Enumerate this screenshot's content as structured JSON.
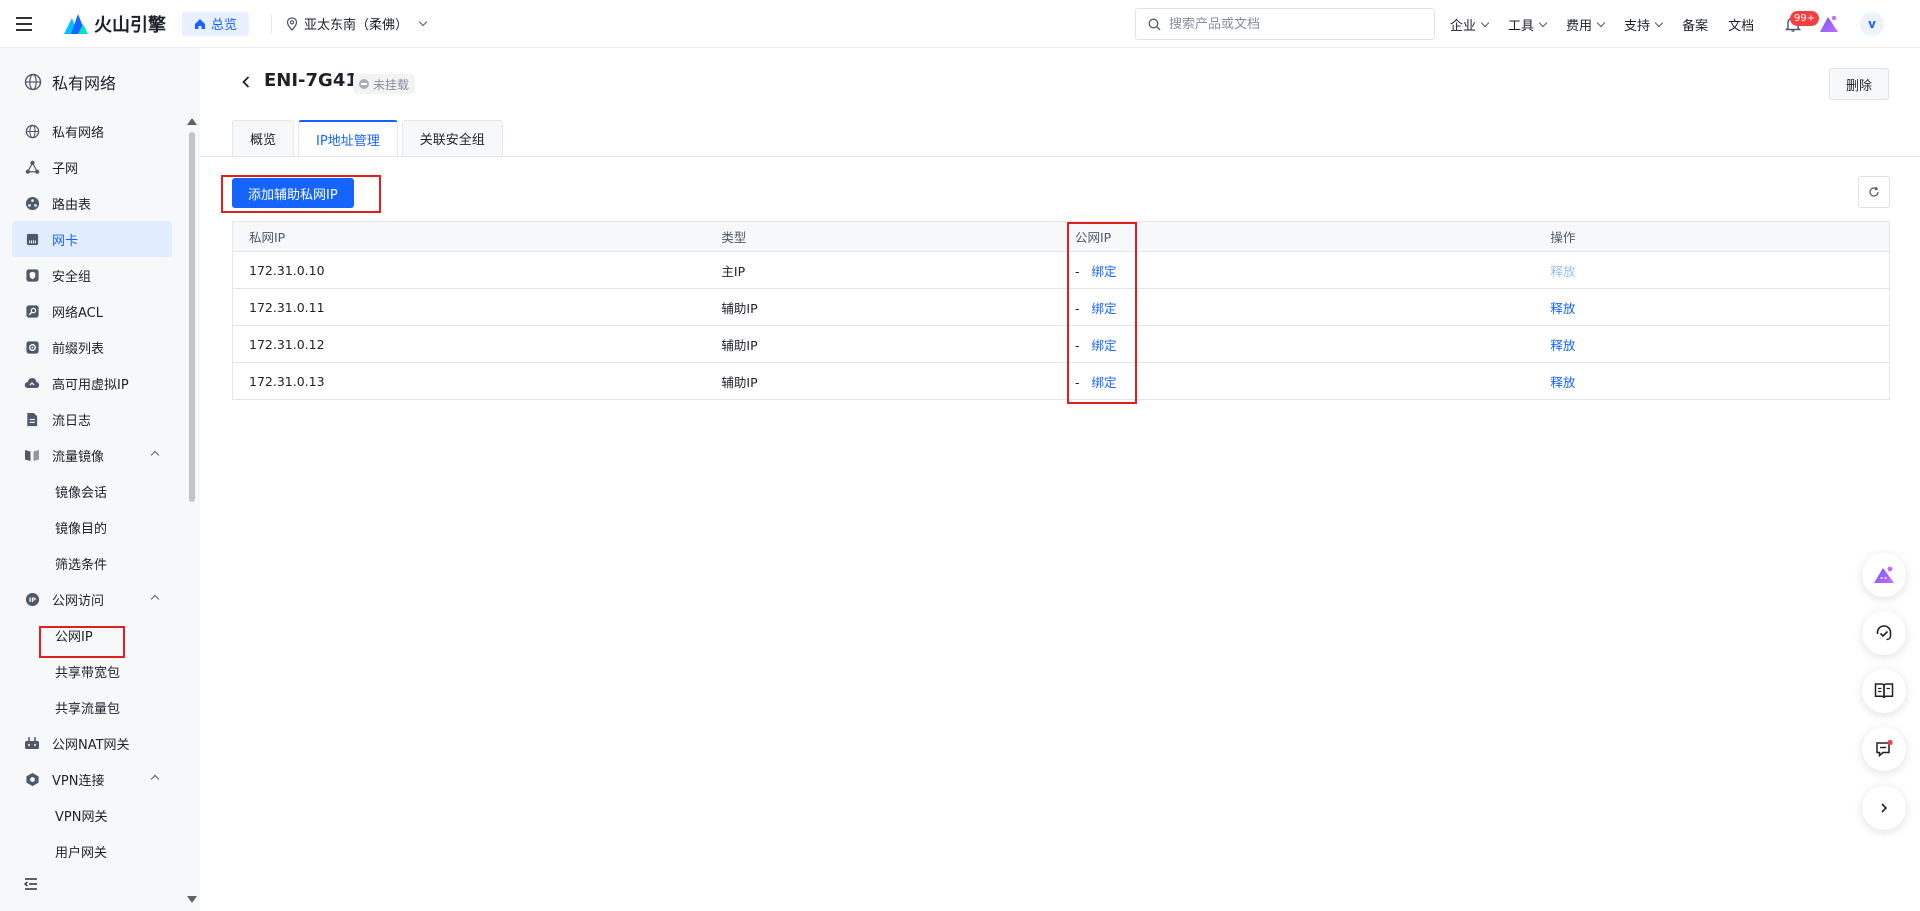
{
  "topbar": {
    "brand": "火山引擎",
    "home_label": "总览",
    "region": "亚太东南（柔佛）",
    "search_placeholder": "搜索产品或文档",
    "nav": [
      {
        "label": "企业",
        "dropdown": true
      },
      {
        "label": "工具",
        "dropdown": true
      },
      {
        "label": "费用",
        "dropdown": true
      },
      {
        "label": "支持",
        "dropdown": true
      },
      {
        "label": "备案",
        "dropdown": false
      },
      {
        "label": "文档",
        "dropdown": false
      }
    ],
    "notification_badge": "99+",
    "avatar_letter": "v"
  },
  "sidebar": {
    "title": "私有网络",
    "items": [
      {
        "label": "私有网络",
        "icon": "globe-icon",
        "type": "item"
      },
      {
        "label": "子网",
        "icon": "subnet-icon",
        "type": "item"
      },
      {
        "label": "路由表",
        "icon": "route-table-icon",
        "type": "item"
      },
      {
        "label": "网卡",
        "icon": "nic-icon",
        "type": "item",
        "active": true
      },
      {
        "label": "安全组",
        "icon": "security-group-icon",
        "type": "item"
      },
      {
        "label": "网络ACL",
        "icon": "acl-icon",
        "type": "item"
      },
      {
        "label": "前缀列表",
        "icon": "prefix-list-icon",
        "type": "item"
      },
      {
        "label": "高可用虚拟IP",
        "icon": "cloud-icon",
        "type": "item"
      },
      {
        "label": "流日志",
        "icon": "flow-log-icon",
        "type": "item"
      },
      {
        "label": "流量镜像",
        "icon": "mirror-icon",
        "type": "group"
      },
      {
        "label": "镜像会话",
        "type": "sub"
      },
      {
        "label": "镜像目的",
        "type": "sub"
      },
      {
        "label": "筛选条件",
        "type": "sub"
      },
      {
        "label": "公网访问",
        "icon": "ip-icon",
        "type": "group"
      },
      {
        "label": "公网IP",
        "type": "sub"
      },
      {
        "label": "共享带宽包",
        "type": "sub"
      },
      {
        "label": "共享流量包",
        "type": "sub"
      },
      {
        "label": "公网NAT网关",
        "icon": "nat-icon",
        "type": "item"
      },
      {
        "label": "VPN连接",
        "icon": "vpn-icon",
        "type": "group"
      },
      {
        "label": "VPN网关",
        "type": "sub"
      },
      {
        "label": "用户网关",
        "type": "sub"
      }
    ]
  },
  "main": {
    "title": "ENI-7G41",
    "status": "未挂载",
    "delete_label": "删除",
    "tabs": [
      {
        "label": "概览",
        "active": false
      },
      {
        "label": "IP地址管理",
        "active": true
      },
      {
        "label": "关联安全组",
        "active": false
      }
    ],
    "add_button": "添加辅助私网IP",
    "table": {
      "headers": [
        "私网IP",
        "类型",
        "公网IP",
        "操作"
      ],
      "rows": [
        {
          "private_ip": "172.31.0.10",
          "type": "主IP",
          "public_ip": "-",
          "bind": "绑定",
          "action": "释放",
          "action_disabled": true
        },
        {
          "private_ip": "172.31.0.11",
          "type": "辅助IP",
          "public_ip": "-",
          "bind": "绑定",
          "action": "释放",
          "action_disabled": false
        },
        {
          "private_ip": "172.31.0.12",
          "type": "辅助IP",
          "public_ip": "-",
          "bind": "绑定",
          "action": "释放",
          "action_disabled": false
        },
        {
          "private_ip": "172.31.0.13",
          "type": "辅助IP",
          "public_ip": "-",
          "bind": "绑定",
          "action": "释放",
          "action_disabled": false
        }
      ]
    }
  },
  "colors": {
    "primary": "#1664ff",
    "highlight_box": "#e02020",
    "sidebar_active_bg": "#e2ecff"
  }
}
